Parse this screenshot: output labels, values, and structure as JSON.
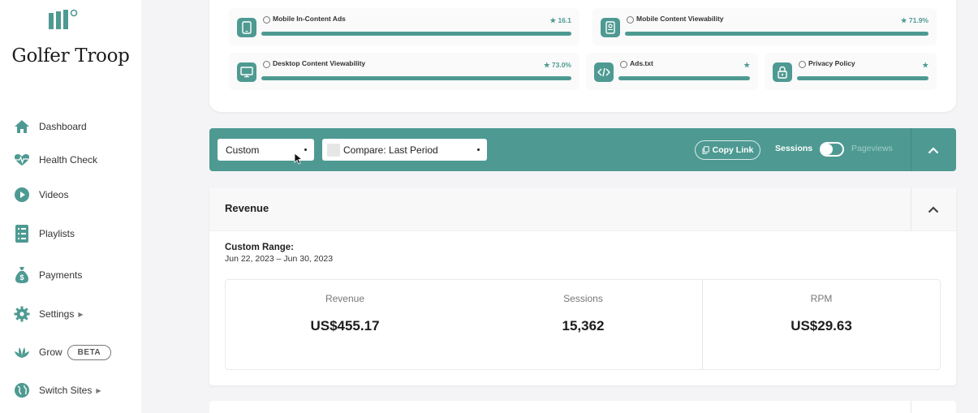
{
  "sidebar": {
    "site_name": "Golfer Troop",
    "items": [
      {
        "label": "Dashboard",
        "icon": "home-icon"
      },
      {
        "label": "Health Check",
        "icon": "heartbeat-icon"
      },
      {
        "label": "Videos",
        "icon": "play-circle-icon"
      },
      {
        "label": "Playlists",
        "icon": "list-icon"
      },
      {
        "label": "Payments",
        "icon": "money-bag-icon"
      },
      {
        "label": "Settings",
        "icon": "gear-icon"
      },
      {
        "label": "Grow",
        "icon": "leaf-icon",
        "badge": "BETA"
      },
      {
        "label": "Switch Sites",
        "icon": "globe-icon"
      }
    ]
  },
  "health": {
    "metrics": [
      {
        "name": "Mobile In-Content Ads",
        "score": "16.1",
        "icon": "mobile-icon"
      },
      {
        "name": "Mobile Content Viewability",
        "score": "71.9%",
        "icon": "mobile-view-icon"
      },
      {
        "name": "Desktop Content Viewability",
        "score": "73.0%",
        "icon": "desktop-icon"
      },
      {
        "name": "Ads.txt",
        "score": "",
        "icon": "code-icon"
      },
      {
        "name": "Privacy Policy",
        "score": "",
        "icon": "lock-icon"
      }
    ]
  },
  "toolbar": {
    "range_select": "Custom",
    "compare_select": "Compare: Last Period",
    "copy_link": "Copy Link",
    "sessions": "Sessions",
    "pageviews": "Pageviews"
  },
  "revenue": {
    "title": "Revenue",
    "range_label": "Custom Range:",
    "range_dates": "Jun 22, 2023 – Jun 30, 2023",
    "stats": [
      {
        "label": "Revenue",
        "value": "US$455.17"
      },
      {
        "label": "Sessions",
        "value": "15,362"
      },
      {
        "label": "RPM",
        "value": "US$29.63"
      }
    ]
  },
  "colors": {
    "accent": "#4e9a92",
    "background": "#f4f4f6"
  }
}
